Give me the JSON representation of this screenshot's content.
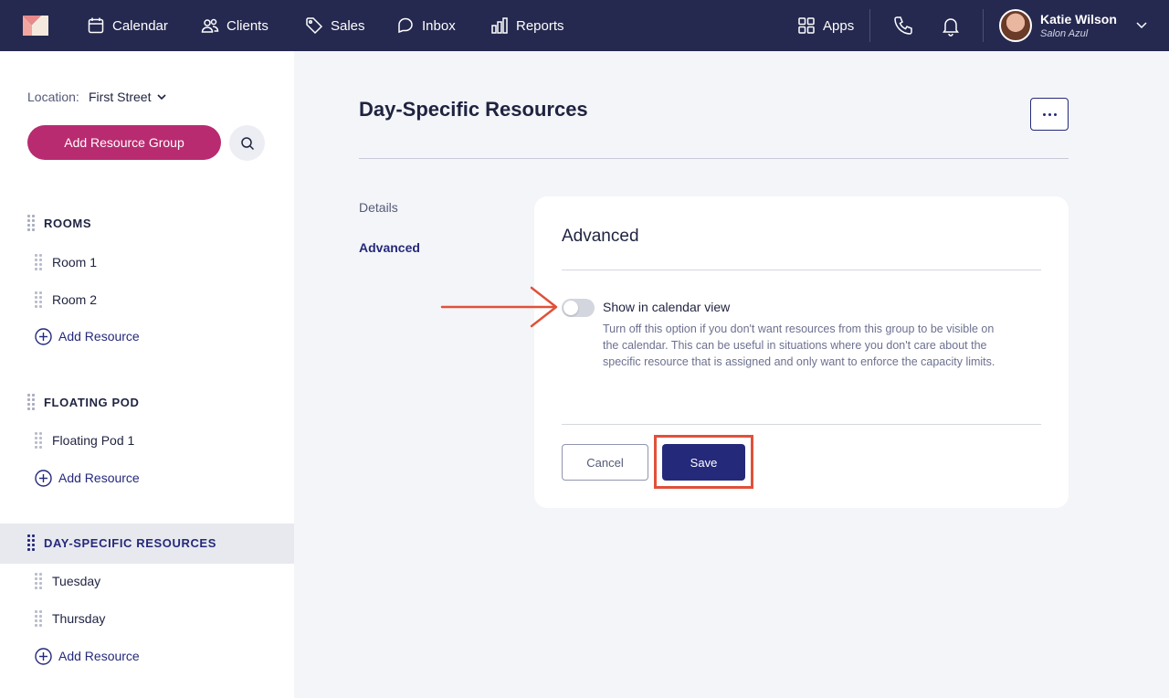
{
  "colors": {
    "nav_bg": "#25294f",
    "accent": "#25297a",
    "brand_pink": "#b82b70",
    "annotation": "#e0513a"
  },
  "nav": {
    "items": [
      {
        "label": "Calendar",
        "icon": "calendar-icon"
      },
      {
        "label": "Clients",
        "icon": "users-icon"
      },
      {
        "label": "Sales",
        "icon": "tag-icon"
      },
      {
        "label": "Inbox",
        "icon": "chat-icon"
      },
      {
        "label": "Reports",
        "icon": "bar-chart-icon"
      }
    ],
    "apps_label": "Apps",
    "user": {
      "name": "Katie Wilson",
      "subtitle": "Salon Azul"
    }
  },
  "sidebar": {
    "location_label": "Location:",
    "location_value": "First Street",
    "add_group_label": "Add Resource Group",
    "groups": [
      {
        "name": "ROOMS",
        "items": [
          "Room 1",
          "Room 2"
        ],
        "add_label": "Add Resource"
      },
      {
        "name": "FLOATING POD",
        "items": [
          "Floating Pod 1"
        ],
        "add_label": "Add Resource"
      },
      {
        "name": "DAY-SPECIFIC RESOURCES",
        "items": [
          "Tuesday",
          "Thursday"
        ],
        "add_label": "Add Resource"
      }
    ]
  },
  "main": {
    "title": "Day-Specific Resources",
    "tabs": [
      {
        "label": "Details"
      },
      {
        "label": "Advanced"
      }
    ],
    "card": {
      "title": "Advanced",
      "option_label": "Show in calendar view",
      "option_enabled": false,
      "option_help": "Turn off this option if you don't want resources from this group to be visible on the calendar. This can be useful in situations where you don't care about the specific resource that is assigned and only want to enforce the capacity limits.",
      "cancel_label": "Cancel",
      "save_label": "Save"
    }
  }
}
